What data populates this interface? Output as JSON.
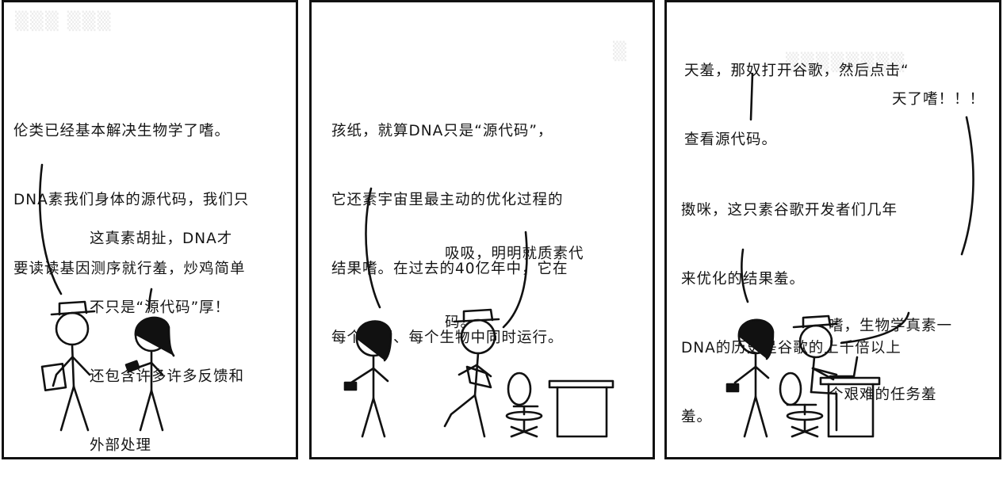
{
  "panels": [
    {
      "captions": [
        "伦类已经基本解决生物学了嗜。",
        "DNA素我们身体的源代码，我们只",
        "要读读基因测序就行羞，炒鸡简单"
      ],
      "reply": [
        "这真素胡扯，DNA才",
        "不只是“源代码”厚！",
        "还包含许多许多反馈和",
        "外部处理"
      ]
    },
    {
      "captions": [
        "孩纸，就算DNA只是“源代码”，",
        "它还素宇宙里最主动的优化过程的",
        "结果嗜。在过去的40亿年中，它在",
        "每个平面、每个生物中同时运行。"
      ],
      "reply": [
        "吸吸，明明就质素代",
        "码。"
      ]
    },
    {
      "top": [
        "天羞，那奴打开谷歌，然后点击“",
        "查看源代码。"
      ],
      "exclaim": "天了嗜！！！",
      "middle": [
        "擞咪，这只素谷歌开发者们几年",
        "来优化的结果羞。",
        "DNA的历史是谷歌的上千倍以上",
        "羞。"
      ],
      "bottom": [
        "嗜，生物学真素一",
        "个艰难的任务羞"
      ]
    }
  ]
}
